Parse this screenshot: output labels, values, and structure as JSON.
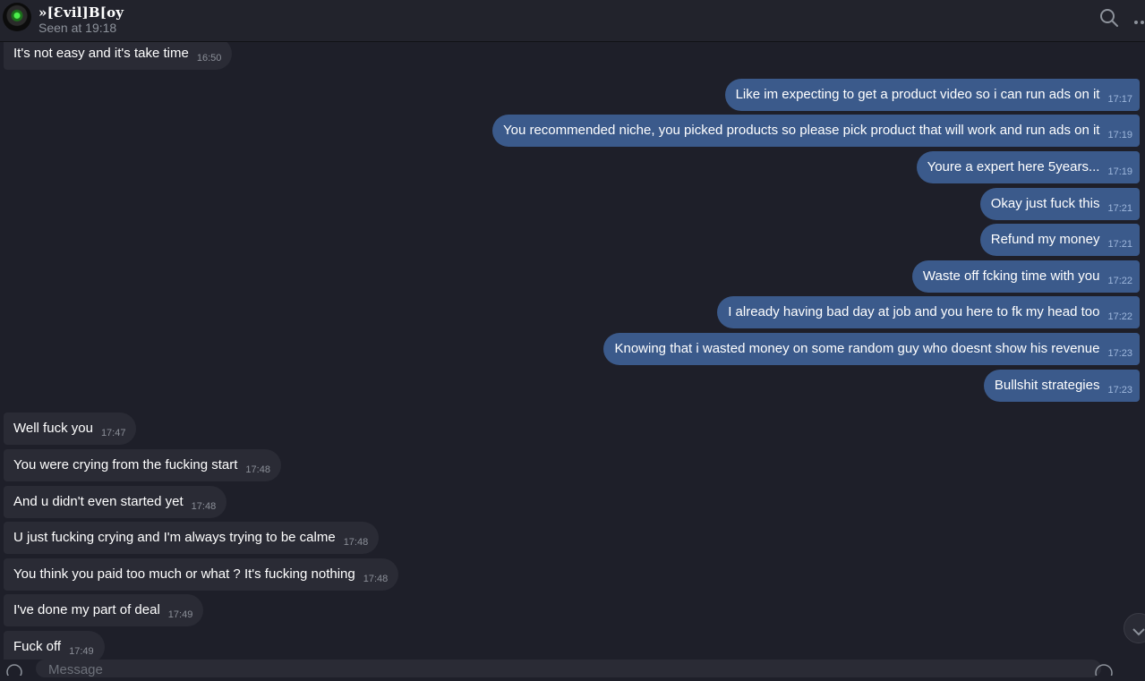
{
  "header": {
    "name": "»[Ɛvil]B[oy",
    "status": "Seen at 19:18",
    "icons": [
      "search-icon",
      "more-icon"
    ]
  },
  "messages": [
    {
      "dir": "in",
      "text": "It's not easy and it's take time",
      "time": "16:50"
    },
    {
      "dir": "out",
      "text": "Like im expecting to get a product video so i can run ads on it",
      "time": "17:17"
    },
    {
      "dir": "out",
      "text": "You recommended niche, you picked products so please pick product that will work and run ads on it",
      "time": "17:19"
    },
    {
      "dir": "out",
      "text": "Youre a expert here 5years...",
      "time": "17:19"
    },
    {
      "dir": "out",
      "text": "Okay just fuck this",
      "time": "17:21"
    },
    {
      "dir": "out",
      "text": "Refund my money",
      "time": "17:21"
    },
    {
      "dir": "out",
      "text": "Waste off fcking time with you",
      "time": "17:22"
    },
    {
      "dir": "out",
      "text": "I already having bad day at job and you here to fk my head too",
      "time": "17:22"
    },
    {
      "dir": "out",
      "text": "Knowing that i wasted money on some random guy who doesnt show his revenue",
      "time": "17:23"
    },
    {
      "dir": "out",
      "text": "Bullshit strategies",
      "time": "17:23"
    },
    {
      "dir": "in",
      "text": "Well fuck you",
      "time": "17:47"
    },
    {
      "dir": "in",
      "text": "You were crying from the fucking start",
      "time": "17:48"
    },
    {
      "dir": "in",
      "text": "And u didn't even started yet",
      "time": "17:48"
    },
    {
      "dir": "in",
      "text": "U just fucking crying and I'm always trying to be calme",
      "time": "17:48"
    },
    {
      "dir": "in",
      "text": "You think you paid too much or what ? It's fucking nothing",
      "time": "17:48"
    },
    {
      "dir": "in",
      "text": "I've done my part of deal",
      "time": "17:49"
    },
    {
      "dir": "in",
      "text": "Fuck off",
      "time": "17:49"
    }
  ],
  "composer": {
    "placeholder": "Message",
    "icons": [
      "emoji-icon",
      "mic-icon"
    ]
  },
  "scroll_button": {
    "icon": "chevron-down-icon"
  }
}
